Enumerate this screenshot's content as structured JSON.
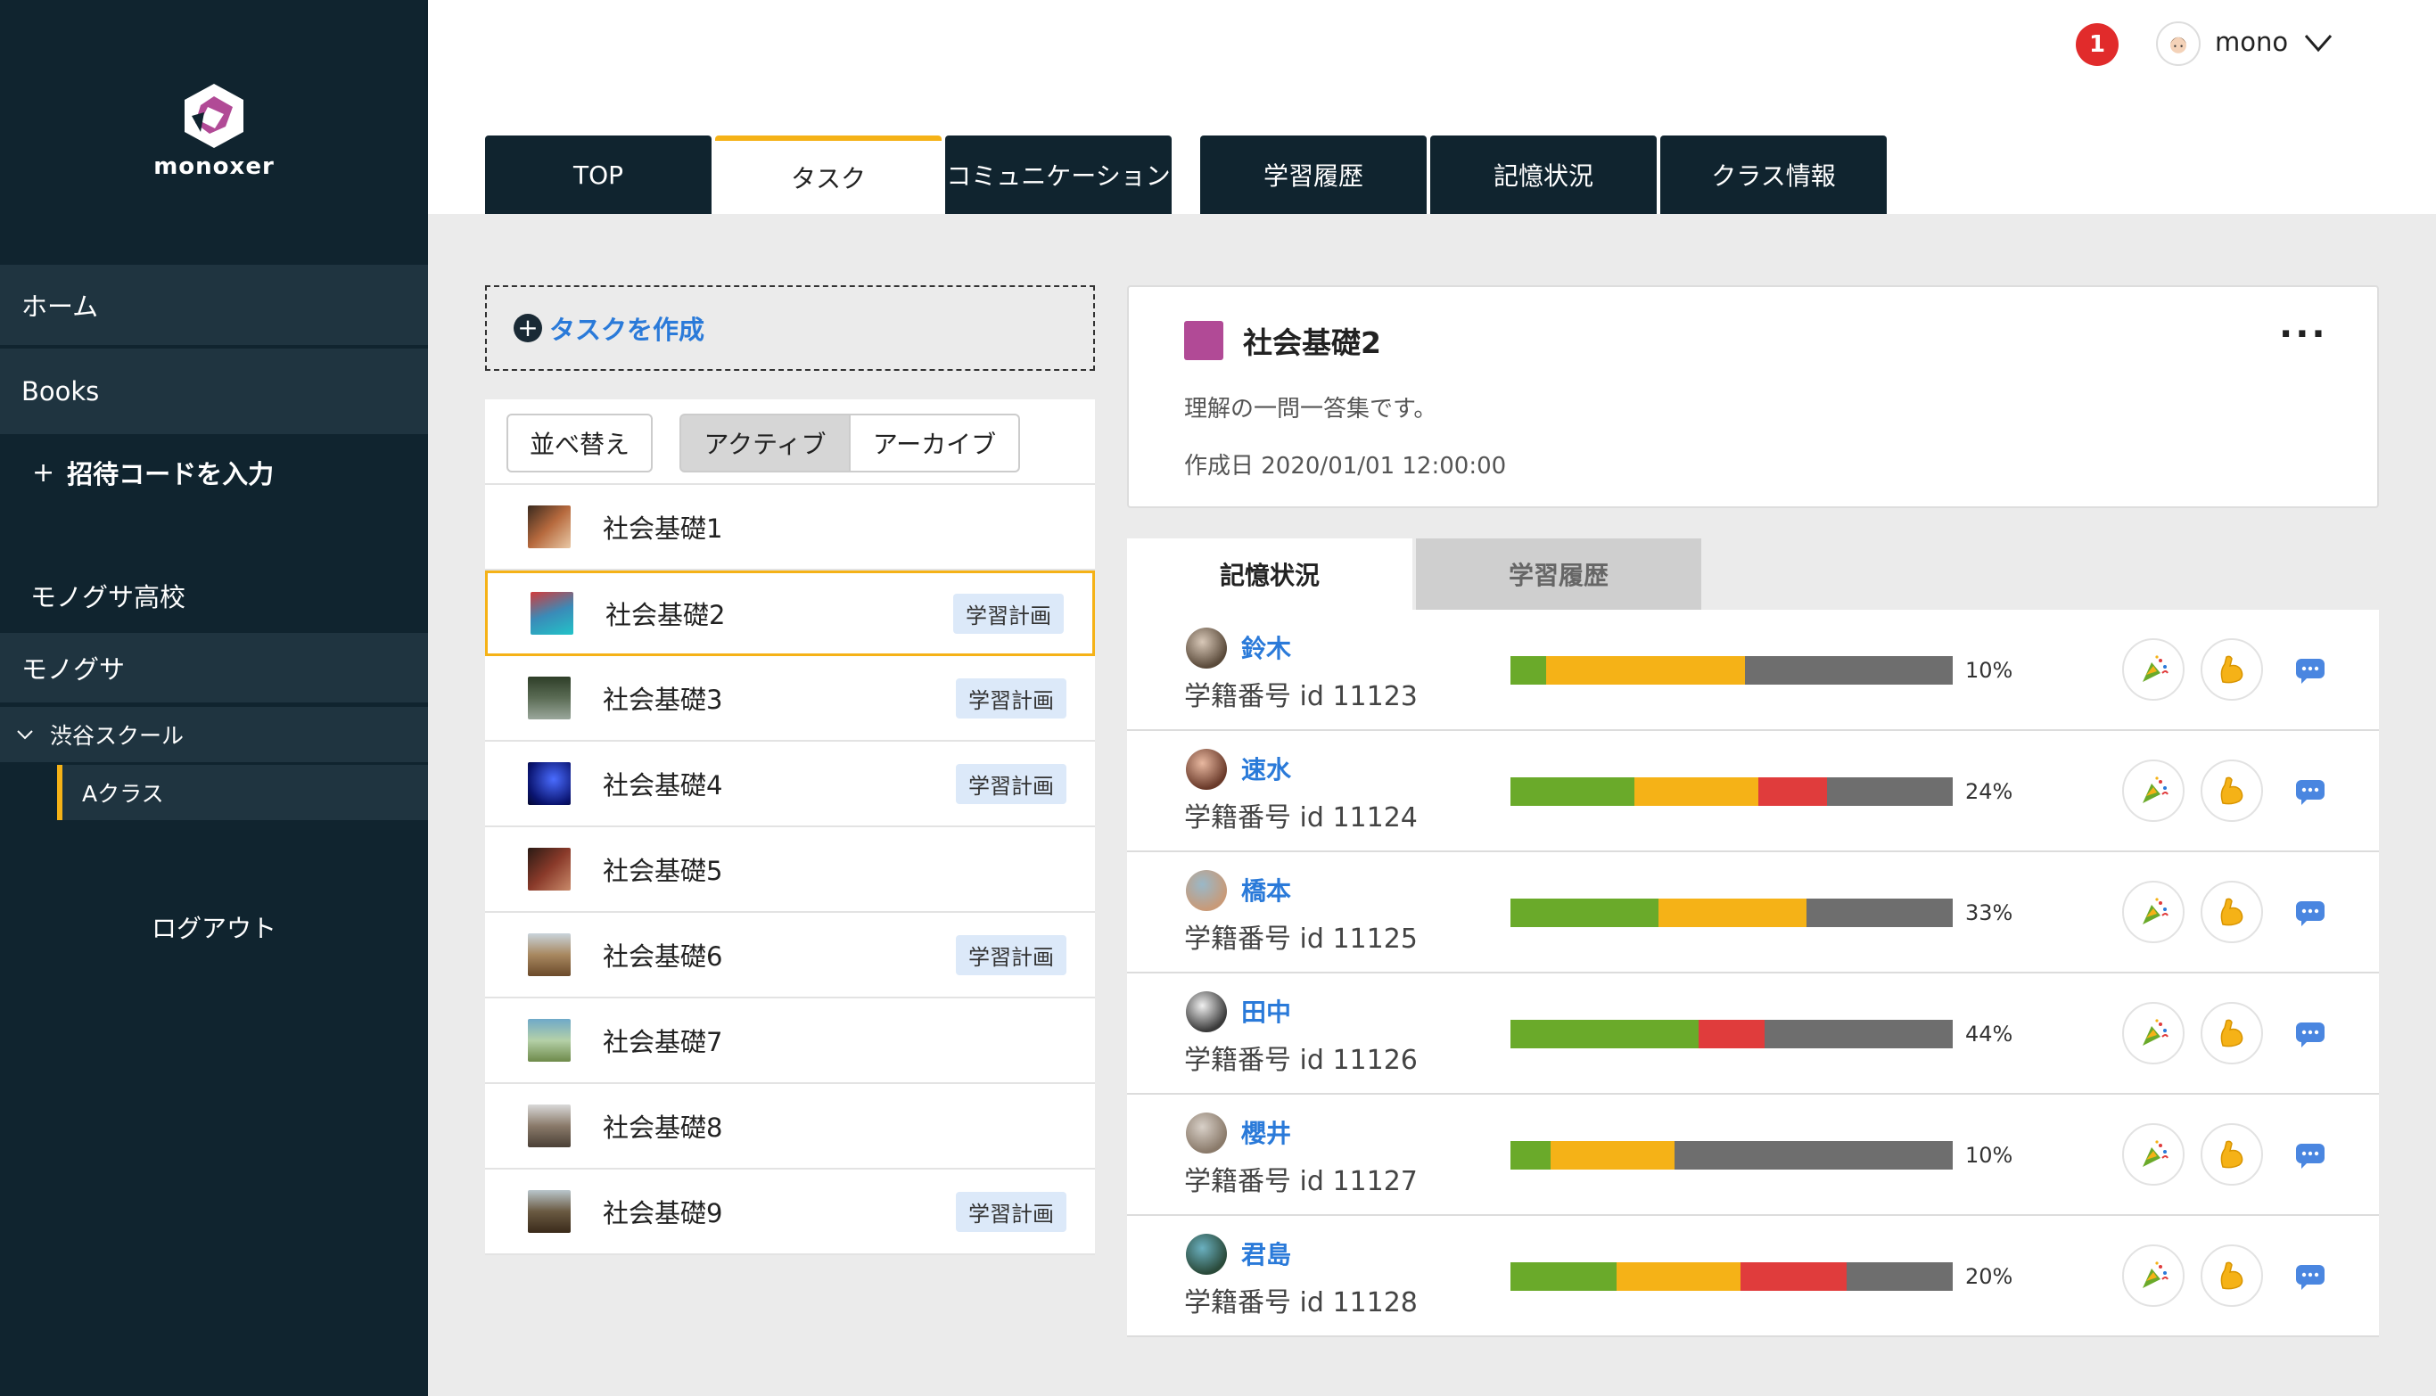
{
  "app": {
    "logo_text": "monoxer"
  },
  "sidebar": {
    "home": "ホーム",
    "books": "Books",
    "invite_plus": "+",
    "invite": "招待コードを入力",
    "school": "モノグサ高校",
    "org": "モノグサ",
    "branch": "渋谷スクール",
    "class": "Aクラス",
    "logout": "ログアウト"
  },
  "header": {
    "notifications": "1",
    "user_name": "mono"
  },
  "tabs": [
    {
      "label": "TOP"
    },
    {
      "label": "タスク"
    },
    {
      "label": "コミュニケーション"
    },
    {
      "label": "学習履歴"
    },
    {
      "label": "記憶状況"
    },
    {
      "label": "クラス情報"
    }
  ],
  "tasks_panel": {
    "create_label": "タスクを作成",
    "sort": "並べ替え",
    "active": "アクティブ",
    "archive": "アーカイブ",
    "badge_label": "学習計画",
    "items": [
      {
        "name": "社会基礎1",
        "badge": ""
      },
      {
        "name": "社会基礎2",
        "badge": "学習計画"
      },
      {
        "name": "社会基礎3",
        "badge": "学習計画"
      },
      {
        "name": "社会基礎4",
        "badge": "学習計画"
      },
      {
        "name": "社会基礎5",
        "badge": ""
      },
      {
        "name": "社会基礎6",
        "badge": "学習計画"
      },
      {
        "name": "社会基礎7",
        "badge": ""
      },
      {
        "name": "社会基礎8",
        "badge": ""
      },
      {
        "name": "社会基礎9",
        "badge": "学習計画"
      }
    ]
  },
  "detail": {
    "title": "社会基礎2",
    "more": "···",
    "description": "理解の一問一答集です。",
    "created": "作成日 2020/01/01 12:00:00",
    "color": "#b14a96"
  },
  "student_tabs": {
    "memory": "記憶状況",
    "history": "学習履歴"
  },
  "colors": {
    "green": "#6aaa2a",
    "yellow": "#f5b217",
    "red": "#e03c3c",
    "gray": "#6e6e6e",
    "accent": "#f5b217",
    "link": "#2a7ad9"
  },
  "students": [
    {
      "name": "鈴木",
      "id": "学籍番号  id 11123",
      "pct": "10%",
      "green": 0.08,
      "yellow": 0.45,
      "red": 0.0
    },
    {
      "name": "速水",
      "id": "学籍番号  id 11124",
      "pct": "24%",
      "green": 0.28,
      "yellow": 0.28,
      "red": 0.155
    },
    {
      "name": "橋本",
      "id": "学籍番号  id 11125",
      "pct": "33%",
      "green": 0.335,
      "yellow": 0.335,
      "red": 0.0
    },
    {
      "name": "田中",
      "id": "学籍番号  id 11126",
      "pct": "44%",
      "green": 0.425,
      "yellow": 0.0,
      "red": 0.15
    },
    {
      "name": "櫻井",
      "id": "学籍番号  id 11127",
      "pct": "10%",
      "green": 0.09,
      "yellow": 0.28,
      "red": 0.0
    },
    {
      "name": "君島",
      "id": "学籍番号  id 11128",
      "pct": "20%",
      "green": 0.24,
      "yellow": 0.28,
      "red": 0.24
    }
  ]
}
